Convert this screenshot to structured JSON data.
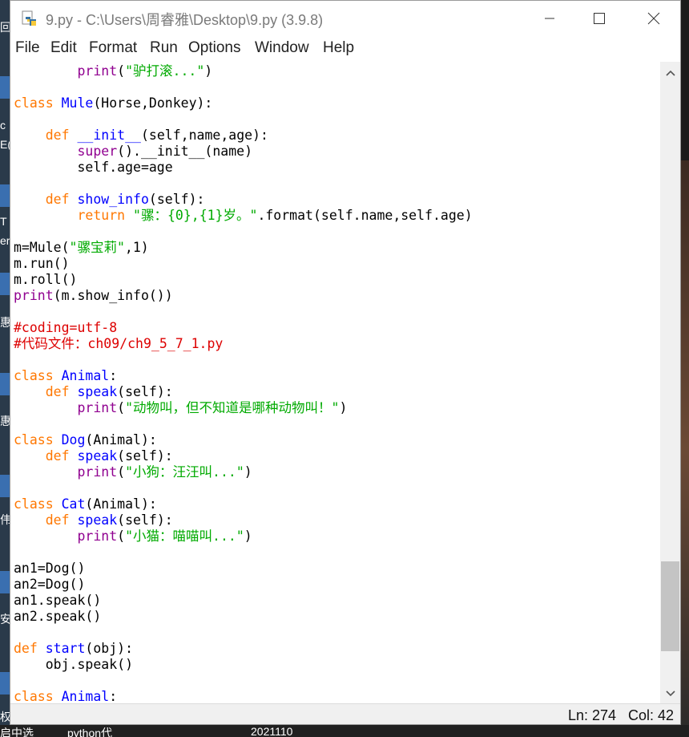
{
  "window": {
    "title": "9.py - C:\\Users\\周睿雅\\Desktop\\9.py (3.9.8)"
  },
  "menu": {
    "items": [
      "File",
      "Edit",
      "Format",
      "Run",
      "Options",
      "Window",
      "Help"
    ]
  },
  "status": {
    "line": "Ln: 274",
    "col": "Col: 42"
  },
  "taskbar": {
    "items": [
      "启中选",
      "python代",
      "2021110"
    ]
  },
  "desktop": {
    "labels": [
      "回",
      "c",
      "E(",
      "T",
      "er",
      "惠",
      "惠",
      "伟",
      "安",
      "权"
    ]
  },
  "code": [
    [
      [
        "        ",
        ""
      ],
      [
        "print",
        "bi"
      ],
      [
        "(",
        ""
      ],
      [
        "\"驴打滚...\"",
        "str"
      ],
      [
        ")",
        ""
      ]
    ],
    [],
    [
      [
        "class",
        "kw"
      ],
      [
        " ",
        ""
      ],
      [
        "Mule",
        "def"
      ],
      [
        "(Horse,Donkey):",
        ""
      ]
    ],
    [],
    [
      [
        "    ",
        ""
      ],
      [
        "def",
        "kw"
      ],
      [
        " ",
        ""
      ],
      [
        "__init__",
        "def"
      ],
      [
        "(self,name,age):",
        ""
      ]
    ],
    [
      [
        "        ",
        ""
      ],
      [
        "super",
        "bi"
      ],
      [
        "().__init__(name)",
        ""
      ]
    ],
    [
      [
        "        self.age=age",
        ""
      ]
    ],
    [],
    [
      [
        "    ",
        ""
      ],
      [
        "def",
        "kw"
      ],
      [
        " ",
        ""
      ],
      [
        "show_info",
        "def"
      ],
      [
        "(self):",
        ""
      ]
    ],
    [
      [
        "        ",
        ""
      ],
      [
        "return",
        "kw"
      ],
      [
        " ",
        ""
      ],
      [
        "\"骡：{0},{1}岁。\"",
        "str"
      ],
      [
        ".format(self.name,self.age)",
        ""
      ]
    ],
    [],
    [
      [
        "m=Mule(",
        ""
      ],
      [
        "\"骡宝莉\"",
        "str"
      ],
      [
        ",1)",
        ""
      ]
    ],
    [
      [
        "m.run()",
        ""
      ]
    ],
    [
      [
        "m.roll()",
        ""
      ]
    ],
    [
      [
        "print",
        "bi"
      ],
      [
        "(m.show_info())",
        ""
      ]
    ],
    [],
    [
      [
        "#coding=utf-8",
        "cmt"
      ]
    ],
    [
      [
        "#代码文件：ch09/ch9_5_7_1.py",
        "cmt"
      ]
    ],
    [],
    [
      [
        "class",
        "kw"
      ],
      [
        " ",
        ""
      ],
      [
        "Animal",
        "def"
      ],
      [
        ":",
        ""
      ]
    ],
    [
      [
        "    ",
        ""
      ],
      [
        "def",
        "kw"
      ],
      [
        " ",
        ""
      ],
      [
        "speak",
        "def"
      ],
      [
        "(self):",
        ""
      ]
    ],
    [
      [
        "        ",
        ""
      ],
      [
        "print",
        "bi"
      ],
      [
        "(",
        ""
      ],
      [
        "\"动物叫，但不知道是哪种动物叫！\"",
        "str"
      ],
      [
        ")",
        ""
      ]
    ],
    [],
    [
      [
        "class",
        "kw"
      ],
      [
        " ",
        ""
      ],
      [
        "Dog",
        "def"
      ],
      [
        "(Animal):",
        ""
      ]
    ],
    [
      [
        "    ",
        ""
      ],
      [
        "def",
        "kw"
      ],
      [
        " ",
        ""
      ],
      [
        "speak",
        "def"
      ],
      [
        "(self):",
        ""
      ]
    ],
    [
      [
        "        ",
        ""
      ],
      [
        "print",
        "bi"
      ],
      [
        "(",
        ""
      ],
      [
        "\"小狗：汪汪叫...\"",
        "str"
      ],
      [
        ")",
        ""
      ]
    ],
    [],
    [
      [
        "class",
        "kw"
      ],
      [
        " ",
        ""
      ],
      [
        "Cat",
        "def"
      ],
      [
        "(Animal):",
        ""
      ]
    ],
    [
      [
        "    ",
        ""
      ],
      [
        "def",
        "kw"
      ],
      [
        " ",
        ""
      ],
      [
        "speak",
        "def"
      ],
      [
        "(self):",
        ""
      ]
    ],
    [
      [
        "        ",
        ""
      ],
      [
        "print",
        "bi"
      ],
      [
        "(",
        ""
      ],
      [
        "\"小猫：喵喵叫...\"",
        "str"
      ],
      [
        ")",
        ""
      ]
    ],
    [],
    [
      [
        "an1=Dog()",
        ""
      ]
    ],
    [
      [
        "an2=Dog()",
        ""
      ]
    ],
    [
      [
        "an1.speak()",
        ""
      ]
    ],
    [
      [
        "an2.speak()",
        ""
      ]
    ],
    [],
    [
      [
        "def",
        "kw"
      ],
      [
        " ",
        ""
      ],
      [
        "start",
        "def"
      ],
      [
        "(obj):",
        ""
      ]
    ],
    [
      [
        "    obj.speak()",
        ""
      ]
    ],
    [],
    [
      [
        "class",
        "kw"
      ],
      [
        " ",
        ""
      ],
      [
        "Animal",
        "def"
      ],
      [
        ":",
        ""
      ]
    ]
  ]
}
